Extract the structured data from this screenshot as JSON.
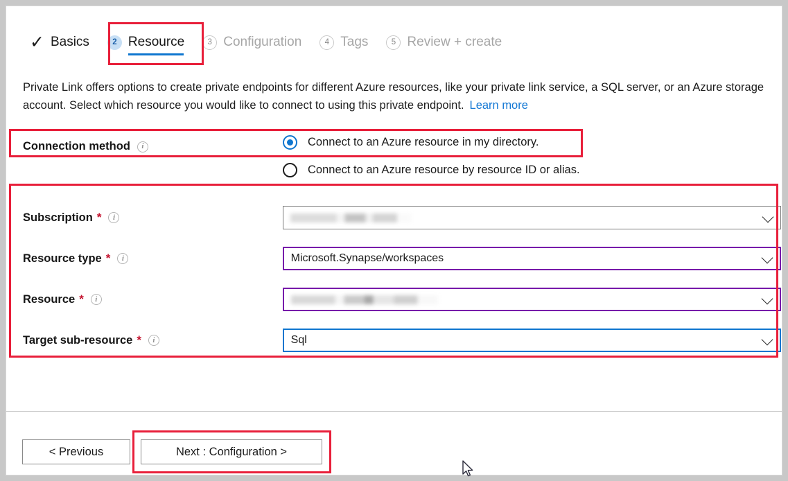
{
  "wizard": {
    "tabs": [
      {
        "id": "basics",
        "badge": "✓",
        "label": "Basics",
        "state": "done"
      },
      {
        "id": "resource",
        "badge": "2",
        "label": "Resource",
        "state": "current"
      },
      {
        "id": "configuration",
        "badge": "3",
        "label": "Configuration",
        "state": "pending"
      },
      {
        "id": "tags",
        "badge": "4",
        "label": "Tags",
        "state": "pending"
      },
      {
        "id": "review",
        "badge": "5",
        "label": "Review + create",
        "state": "pending"
      }
    ]
  },
  "intro": {
    "text": "Private Link offers options to create private endpoints for different Azure resources, like your private link service, a SQL server, or an Azure storage account. Select which resource you would like to connect to using this private endpoint.",
    "link_label": "Learn more"
  },
  "connection_method": {
    "label": "Connection method",
    "info_icon": "info-icon",
    "options": [
      {
        "label": "Connect to an Azure resource in my directory.",
        "selected": true
      },
      {
        "label": "Connect to an Azure resource by resource ID or alias.",
        "selected": false
      }
    ]
  },
  "fields": [
    {
      "id": "subscription",
      "label": "Subscription",
      "required": "*",
      "value": "",
      "redacted": true,
      "border": "gray"
    },
    {
      "id": "resource-type",
      "label": "Resource type",
      "required": "*",
      "value": "Microsoft.Synapse/workspaces",
      "redacted": false,
      "border": "purple"
    },
    {
      "id": "resource",
      "label": "Resource",
      "required": "*",
      "value": "",
      "redacted": true,
      "border": "purple"
    },
    {
      "id": "target-sub-resource",
      "label": "Target sub-resource",
      "required": "*",
      "value": "Sql",
      "redacted": false,
      "border": "blue"
    }
  ],
  "footer": {
    "previous_label": "< Previous",
    "next_label": "Next : Configuration >"
  },
  "annotations": {
    "highlight_color": "#e81f3a",
    "boxes": [
      "resource-tab",
      "connection-method-row",
      "resource-fields-group",
      "next-button"
    ]
  },
  "colors": {
    "accent_blue": "#0f76cf",
    "link_blue": "#1478d4",
    "required_red": "#c4122e",
    "purple_border": "#7719aa",
    "highlight_red": "#e81f3a"
  }
}
